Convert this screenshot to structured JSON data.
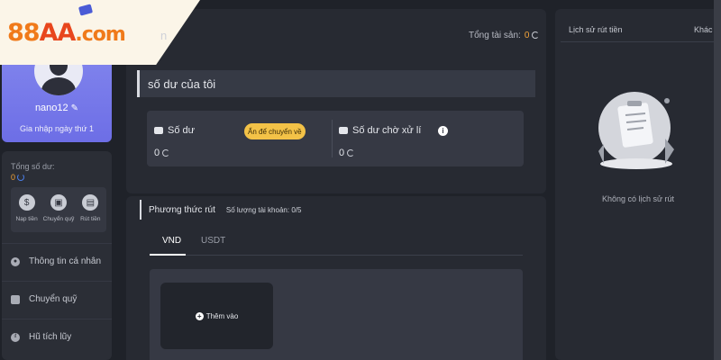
{
  "logo": {
    "part1": "88",
    "part2": "AA",
    "part3": ".com"
  },
  "profile": {
    "username": "nano12",
    "edit_icon": "pencil-icon",
    "joined": "Gia nhập ngày thứ 1"
  },
  "sidebar": {
    "total_label": "Tổng số dư:",
    "total_value": "0",
    "quick_actions": [
      {
        "label": "Nạp tiền",
        "icon": "deposit-icon"
      },
      {
        "label": "Chuyển quỹ",
        "icon": "wallet-icon"
      },
      {
        "label": "Rút tiền",
        "icon": "withdraw-icon"
      }
    ],
    "menu": [
      {
        "label": "Thông tin cá nhân",
        "icon": "user-icon"
      },
      {
        "label": "Chuyển quỹ",
        "icon": "wallet-icon"
      },
      {
        "label": "Hũ tích lũy",
        "icon": "savings-icon"
      }
    ]
  },
  "main": {
    "title_suffix": "n",
    "asset_total_label": "Tổng tài sản:",
    "asset_total_value": "0",
    "balance_section_title": "số dư của tôi",
    "balance_label": "Số dư",
    "hide_button": "Ẩn để chuyển về",
    "balance_value": "0",
    "pending_label": "Số dư chờ xử lí",
    "pending_value": "0"
  },
  "withdraw": {
    "title": "Phương thức rút",
    "account_count_label": "Số lượng tài khoản:",
    "account_count": "0/5",
    "tabs": [
      {
        "label": "VND"
      },
      {
        "label": "USDT"
      }
    ],
    "add_label": "Thêm vào"
  },
  "history": {
    "title": "Lịch sử rút tiền",
    "other": "Khác >",
    "empty": "Không có lịch sử rút"
  },
  "colors": {
    "accent_purple": "#7b7fee",
    "highlight_yellow": "#f3c247",
    "value_orange": "#f2a33a"
  }
}
